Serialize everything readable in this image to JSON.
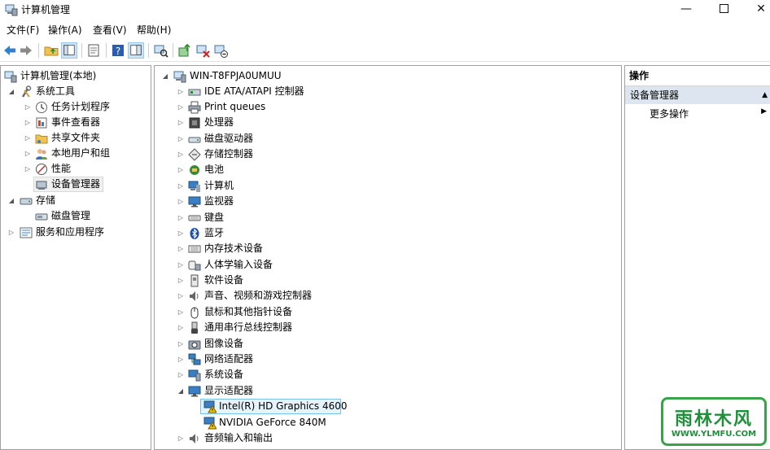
{
  "window": {
    "title": "计算机管理",
    "controls": {
      "minimize": "—",
      "close": "✕"
    }
  },
  "menu": [
    "文件(F)",
    "操作(A)",
    "查看(V)",
    "帮助(H)"
  ],
  "toolbar": {
    "buttons": [
      "back-arrow-icon",
      "forward-arrow-icon",
      "folder-up-icon",
      "console-tree-icon",
      "properties-icon",
      "help-icon",
      "show-pane-icon",
      "scan-hardware-icon",
      "update-driver-icon",
      "uninstall-device-icon",
      "disable-device-icon"
    ]
  },
  "left_tree": {
    "root": "计算机管理(本地)",
    "system_tools": "系统工具",
    "system_children": [
      "任务计划程序",
      "事件查看器",
      "共享文件夹",
      "本地用户和组",
      "性能",
      "设备管理器"
    ],
    "storage": "存储",
    "storage_children": [
      "磁盘管理"
    ],
    "services": "服务和应用程序"
  },
  "device_tree": {
    "root": "WIN-T8FPJA0UMUU",
    "categories": [
      "IDE ATA/ATAPI 控制器",
      "Print queues",
      "处理器",
      "磁盘驱动器",
      "存储控制器",
      "电池",
      "计算机",
      "监视器",
      "键盘",
      "蓝牙",
      "内存技术设备",
      "人体学输入设备",
      "软件设备",
      "声音、视频和游戏控制器",
      "鼠标和其他指针设备",
      "通用串行总线控制器",
      "图像设备",
      "网络适配器",
      "系统设备",
      "显示适配器"
    ],
    "display_children": [
      "Intel(R) HD Graphics 4600",
      "NVIDIA GeForce 840M"
    ],
    "last_category": "音频输入和输出"
  },
  "actions": {
    "header": "操作",
    "section": "设备管理器",
    "more": "更多操作"
  },
  "watermark": {
    "top": "雨林木风",
    "bottom": "WWW.YLMFU.COM"
  },
  "colors": {
    "selection": "#e5f3fb",
    "selection_border": "#7ac0e8",
    "action_section": "#dde6f0",
    "logo_green": "#1f8f3a"
  }
}
